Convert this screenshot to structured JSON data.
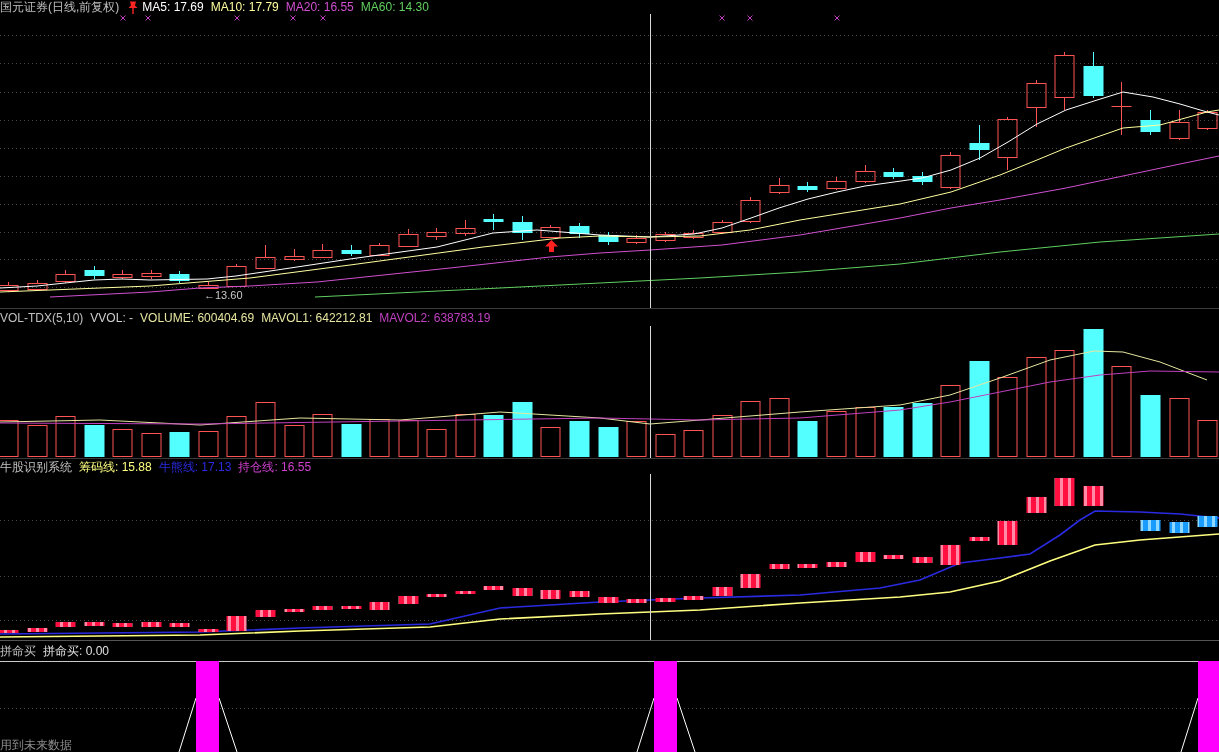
{
  "price_panel": {
    "title": "国元证券(日线,前复权)",
    "legend": [
      {
        "label": "MA5: 17.69",
        "color": "#ffffff"
      },
      {
        "label": "MA10: 17.79",
        "color": "#ffffa0"
      },
      {
        "label": "MA20: 16.55",
        "color": "#d050d0"
      },
      {
        "label": "MA60: 14.30",
        "color": "#60d060"
      }
    ],
    "low_label": "←13.60"
  },
  "volume_panel": {
    "title": "VOL-TDX(5,10)",
    "legend": [
      {
        "label": "VVOL: -",
        "color": "#d0d0d0"
      },
      {
        "label": "VOLUME: 600404.69",
        "color": "#e6e6a0"
      },
      {
        "label": "MAVOL1: 642212.81",
        "color": "#e6e6a0"
      },
      {
        "label": "MAVOL2: 638783.19",
        "color": "#c040c0"
      }
    ]
  },
  "indicator_panel": {
    "title": "牛股识别系统",
    "legend": [
      {
        "label": "筹码线: 15.88",
        "color": "#ffff80"
      },
      {
        "label": "牛熊线: 17.13",
        "color": "#2a2ae0"
      },
      {
        "label": "持仓线: 16.55",
        "color": "#d040d0"
      }
    ]
  },
  "signal_panel": {
    "title": "拼命买",
    "legend": [
      {
        "label": "拼命买: 0.00"
      }
    ],
    "note": "用到未来数据"
  }
}
